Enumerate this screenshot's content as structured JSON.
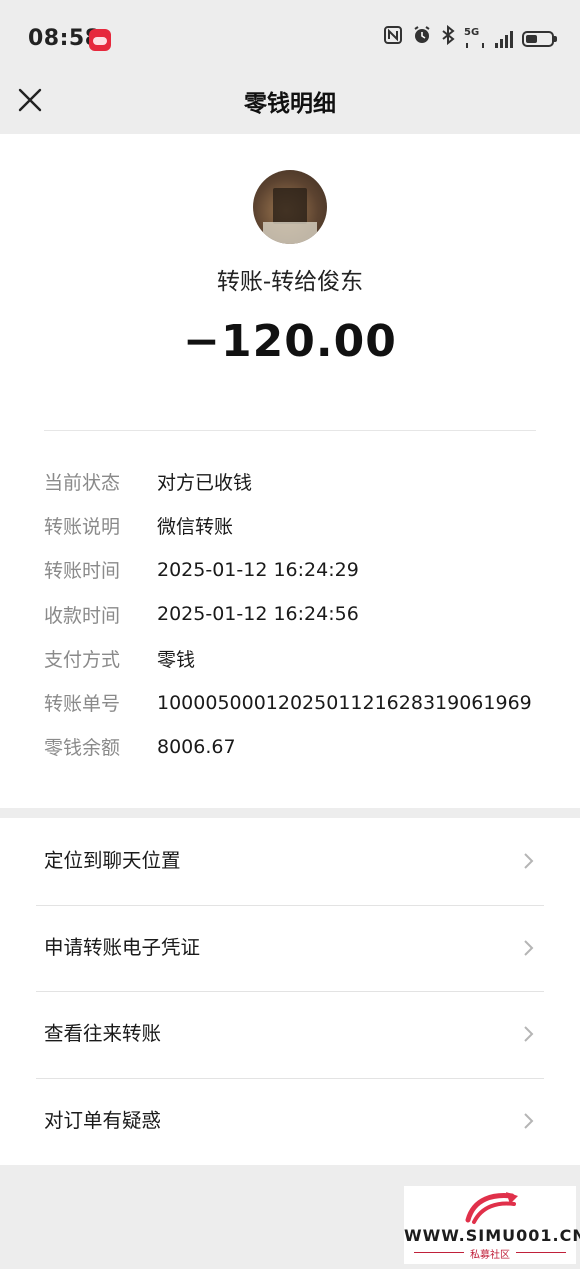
{
  "status_bar": {
    "time": "08:58",
    "network": "5G",
    "icons": [
      "app-notification-icon",
      "nfc-icon",
      "alarm-icon",
      "bluetooth-icon",
      "5g-signal-icon",
      "battery-icon"
    ]
  },
  "nav": {
    "title": "零钱明细",
    "close_icon": "close-icon"
  },
  "transaction": {
    "title": "转账-转给俊东",
    "amount": "−120.00"
  },
  "details": [
    {
      "label": "当前状态",
      "value": "对方已收钱"
    },
    {
      "label": "转账说明",
      "value": "微信转账"
    },
    {
      "label": "转账时间",
      "value": "2025-01-12 16:24:29"
    },
    {
      "label": "收款时间",
      "value": "2025-01-12 16:24:56"
    },
    {
      "label": "支付方式",
      "value": "零钱"
    },
    {
      "label": "转账单号",
      "value": "1000050001202501121628319061969"
    },
    {
      "label": "零钱余额",
      "value": "8006.67"
    }
  ],
  "actions": [
    {
      "label": "定位到聊天位置"
    },
    {
      "label": "申请转账电子凭证"
    },
    {
      "label": "查看往来转账"
    },
    {
      "label": "对订单有疑惑"
    }
  ],
  "watermark": {
    "url": "WWW.SIMU001.CN",
    "subtitle": "私募社区"
  },
  "colors": {
    "background": "#ededed",
    "card": "#ffffff",
    "label_gray": "#8a8a8a",
    "watermark_red": "#c0203a"
  }
}
